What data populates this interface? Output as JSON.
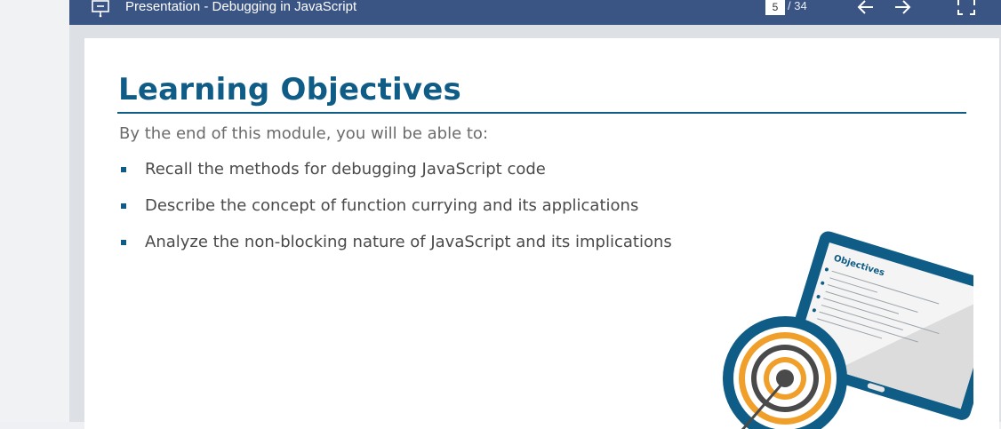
{
  "viewer": {
    "title": "Presentation - Debugging in JavaScript",
    "current_page": "5",
    "total_pages": "/ 34",
    "icons": {
      "presentation": "presentation-icon",
      "prev": "arrow-left-icon",
      "next": "arrow-right-icon",
      "fullscreen": "fullscreen-icon"
    },
    "colors": {
      "topbar": "#3a5484",
      "accent": "#0f5d86",
      "target_orange": "#f0a02a"
    }
  },
  "slide": {
    "heading": "Learning Objectives",
    "intro": "By the end of this module, you will be able to:",
    "objectives": [
      "Recall the methods for debugging JavaScript code",
      "Describe the concept of function currying and its applications",
      "Analyze the non-blocking nature of JavaScript and its implications"
    ],
    "illustration": {
      "tablet_title": "Objectives"
    }
  }
}
